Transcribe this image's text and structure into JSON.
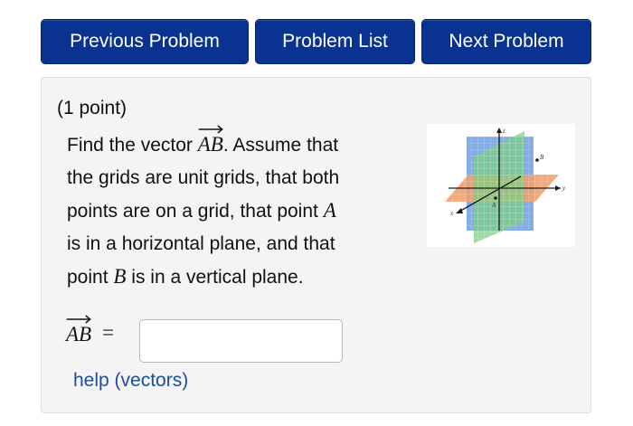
{
  "nav": {
    "previous_label": "Previous Problem",
    "list_label": "Problem List",
    "next_label": "Next Problem"
  },
  "problem": {
    "points": "(1 point)",
    "find_text": "Find the vector",
    "vector_name": "AB",
    "after_vector": ". Assume that",
    "line2": "the grids are unit grids, that both",
    "line3a": "points are on a grid, that point",
    "point_a": "A",
    "line4": "is in a horizontal plane, and that",
    "line5a": "point",
    "point_b": "B",
    "line5b": "is in a vertical plane."
  },
  "figure": {
    "axis_z": "z",
    "axis_y": "y",
    "axis_x": "x",
    "point_a": "A",
    "point_b": "B"
  },
  "answer": {
    "vector_name": "AB",
    "equals": "=",
    "value": "",
    "help_label": "help (vectors)"
  },
  "colors": {
    "nav_button": "#0a3290",
    "panel_bg": "#f4f4f4",
    "link": "#1d4e9a",
    "plane_blue": "#6f9ee0",
    "plane_green": "#7fcf86",
    "plane_orange": "#f0a070"
  }
}
